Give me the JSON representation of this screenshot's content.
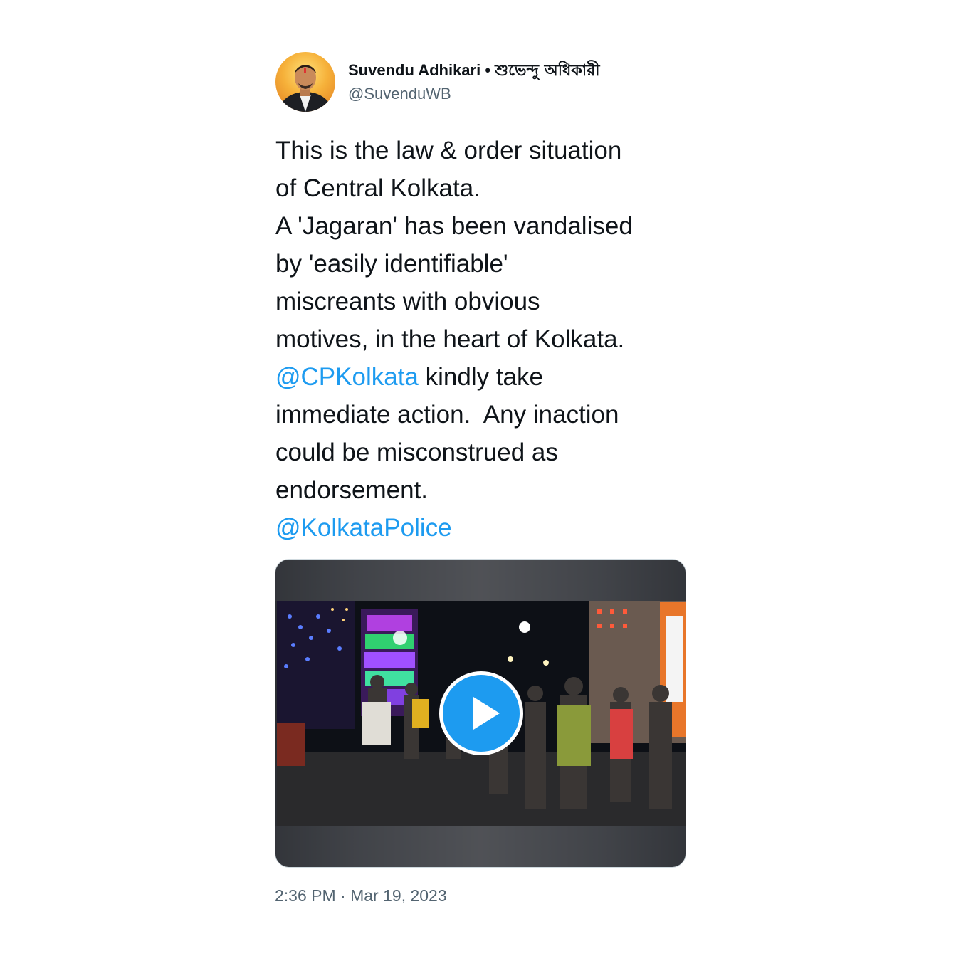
{
  "author": {
    "name": "Suvendu Adhikari",
    "separator": "•",
    "name_bengali": "শুভেন্দু অধিকারী",
    "handle": "@SuvenduWB"
  },
  "tweet": {
    "lines": [
      [
        {
          "text": "This is the law & order situation"
        }
      ],
      [
        {
          "text": "of Central Kolkata."
        }
      ],
      [
        {
          "text": "A 'Jagaran' has been vandalised"
        }
      ],
      [
        {
          "text": "by 'easily identifiable'"
        }
      ],
      [
        {
          "text": "miscreants with obvious"
        }
      ],
      [
        {
          "text": "motives, in the heart of Kolkata."
        }
      ],
      [
        {
          "text": "@CPKolkata",
          "mention": true
        },
        {
          "text": " kindly take"
        }
      ],
      [
        {
          "text": "immediate action.  Any inaction"
        }
      ],
      [
        {
          "text": "could be misconstrued as"
        }
      ],
      [
        {
          "text": "endorsement."
        }
      ],
      [
        {
          "text": "@KolkataPolice",
          "mention": true
        }
      ]
    ]
  },
  "media": {
    "type": "video",
    "play_icon": "play-icon"
  },
  "timestamp": {
    "time": "2:36 PM",
    "separator": "·",
    "date": "Mar 19, 2023"
  },
  "colors": {
    "text": "#0f1419",
    "secondary": "#536471",
    "link": "#1d9bf0",
    "border": "#cfd9de"
  }
}
